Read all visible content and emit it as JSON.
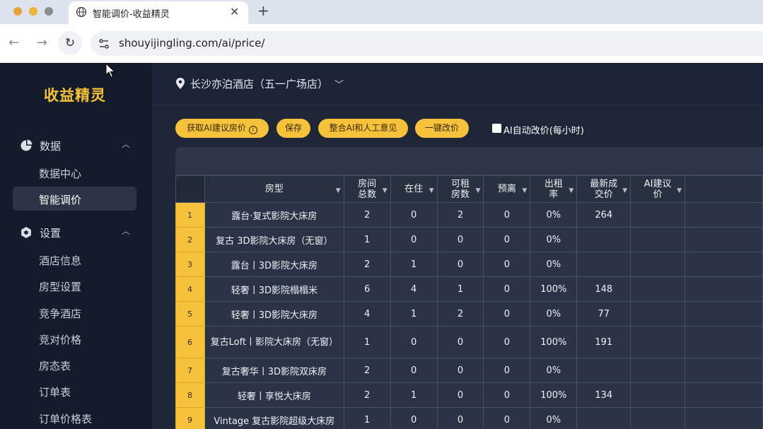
{
  "browser": {
    "tab_title": "智能调价-收益精灵",
    "url": "shouyijingling.com/ai/price/"
  },
  "sidebar": {
    "logo": "收益精灵",
    "sections": [
      {
        "label": "数据",
        "icon": "pie-chart-icon",
        "items": [
          "数据中心",
          "智能调价"
        ]
      },
      {
        "label": "设置",
        "icon": "gear-icon",
        "items": [
          "酒店信息",
          "房型设置",
          "竞争酒店",
          "竞对价格",
          "房态表",
          "订单表",
          "订单价格表"
        ]
      }
    ],
    "active_item": "智能调价"
  },
  "header": {
    "hotel_name": "长沙亦泊酒店（五一广场店）"
  },
  "toolbar": {
    "fetch_label": "获取AI建议房价",
    "save_label": "保存",
    "merge_label": "整合AI和人工意见",
    "apply_label": "一键改价",
    "auto_label": "AI自动改价(每小时)",
    "auto_checked": false
  },
  "table": {
    "columns": [
      "房型",
      "房间总数",
      "在住",
      "可租房数",
      "预离",
      "出租率",
      "最新成交价",
      "AI建议价"
    ],
    "column_headers_display": [
      [
        "房型"
      ],
      [
        "房间",
        "总数"
      ],
      [
        "在住"
      ],
      [
        "可租",
        "房数"
      ],
      [
        "预离"
      ],
      [
        "出租",
        "率"
      ],
      [
        "最新成",
        "交价"
      ],
      [
        "AI建议",
        "价"
      ]
    ],
    "rows": [
      {
        "num": "1",
        "room_type": "露台·复式影院大床房",
        "total": "2",
        "occupied": "0",
        "available": "2",
        "departing": "0",
        "rate": "0%",
        "latest_price": "264",
        "ai_price": ""
      },
      {
        "num": "2",
        "room_type": "复古 3D影院大床房（无窗）",
        "total": "1",
        "occupied": "0",
        "available": "0",
        "departing": "0",
        "rate": "0%",
        "latest_price": "",
        "ai_price": ""
      },
      {
        "num": "3",
        "room_type": "露台丨3D影院大床房",
        "total": "2",
        "occupied": "1",
        "available": "0",
        "departing": "0",
        "rate": "0%",
        "latest_price": "",
        "ai_price": ""
      },
      {
        "num": "4",
        "room_type": "轻奢丨3D影院榻榻米",
        "total": "6",
        "occupied": "4",
        "available": "1",
        "departing": "0",
        "rate": "100%",
        "latest_price": "148",
        "ai_price": ""
      },
      {
        "num": "5",
        "room_type": "轻奢丨3D影院大床房",
        "total": "4",
        "occupied": "1",
        "available": "2",
        "departing": "0",
        "rate": "0%",
        "latest_price": "77",
        "ai_price": ""
      },
      {
        "num": "6",
        "room_type": "复古Loft丨影院大床房（无窗）",
        "total": "1",
        "occupied": "0",
        "available": "0",
        "departing": "0",
        "rate": "100%",
        "latest_price": "191",
        "ai_price": ""
      },
      {
        "num": "7",
        "room_type": "复古奢华丨3D影院双床房",
        "total": "2",
        "occupied": "0",
        "available": "0",
        "departing": "0",
        "rate": "0%",
        "latest_price": "",
        "ai_price": ""
      },
      {
        "num": "8",
        "room_type": "轻奢丨享悦大床房",
        "total": "2",
        "occupied": "1",
        "available": "0",
        "departing": "0",
        "rate": "100%",
        "latest_price": "134",
        "ai_price": ""
      },
      {
        "num": "9",
        "room_type": "Vintage 复古影院超级大床房",
        "total": "1",
        "occupied": "0",
        "available": "0",
        "departing": "0",
        "rate": "0%",
        "latest_price": "",
        "ai_price": ""
      }
    ]
  },
  "colors": {
    "accent": "#f6c23b",
    "sidebar_bg": "#141c2c",
    "main_bg": "#1b2436"
  }
}
